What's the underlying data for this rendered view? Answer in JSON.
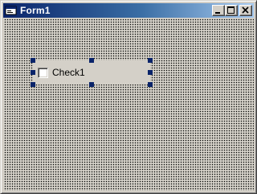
{
  "window": {
    "title": "Form1"
  },
  "form": {
    "checkbox": {
      "label": "Check1",
      "checked": false
    }
  },
  "colors": {
    "title_gradient_start": "#0a246a",
    "title_gradient_end": "#a6caf0",
    "face": "#d4d0c8",
    "selection_handle": "#0a246a"
  },
  "icons": {
    "title": "form-icon",
    "minimize": "minimize-icon",
    "maximize": "maximize-icon",
    "close": "close-icon"
  }
}
